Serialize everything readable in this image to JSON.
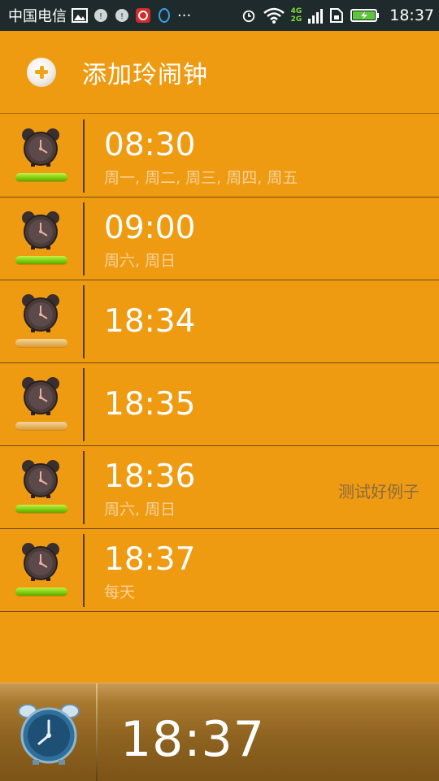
{
  "status_bar": {
    "carrier": "中国电信",
    "network_labels": [
      "4G",
      "2G"
    ],
    "time": "18:37"
  },
  "header": {
    "add_label": "添加玲闹钟"
  },
  "alarms": [
    {
      "time": "08:30",
      "days": "周一, 周二, 周三, 周四, 周五",
      "note": "",
      "enabled": true
    },
    {
      "time": "09:00",
      "days": "周六, 周日",
      "note": "",
      "enabled": true
    },
    {
      "time": "18:34",
      "days": "",
      "note": "",
      "enabled": false
    },
    {
      "time": "18:35",
      "days": "",
      "note": "",
      "enabled": false
    },
    {
      "time": "18:36",
      "days": "周六, 周日",
      "note": "测试好例子",
      "enabled": true
    },
    {
      "time": "18:37",
      "days": "每天",
      "note": "",
      "enabled": true
    }
  ],
  "footer": {
    "current_time": "18:37"
  },
  "colors": {
    "background": "#ee9b12",
    "toggle_on": "#7ccc0a",
    "toggle_off": "#e7b460",
    "status_bar": "#1f2a2c"
  },
  "icons": {
    "add": "plus-circle-icon",
    "alarm": "alarm-clock-icon",
    "footer": "analog-alarm-clock-icon"
  }
}
